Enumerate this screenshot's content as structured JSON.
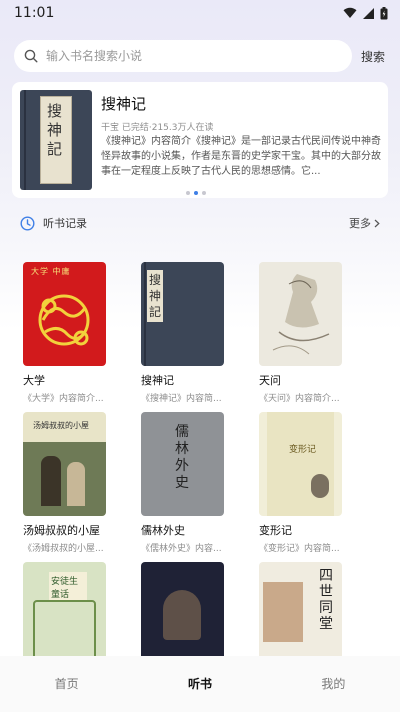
{
  "status_bar": {
    "time": "11:01"
  },
  "search": {
    "placeholder": "输入书名搜索小说",
    "button_label": "搜索"
  },
  "featured": {
    "title": "搜神记",
    "meta": "干宝 已完结·215.3万人在读",
    "description": "《搜神记》内容简介《搜神记》是一部记录古代民间传说中神奇怪异故事的小说集，作者是东晋的史学家干宝。其中的大部分故事在一定程度上反映了古代人民的思想感情。它...",
    "cover_text": "搜神記"
  },
  "carousel": {
    "count": 3,
    "active": 1
  },
  "history": {
    "label": "听书记录",
    "more_label": "更多"
  },
  "books": [
    {
      "title": "大学",
      "desc": "《大学》内容简介...",
      "cover_top": "大学 中庸"
    },
    {
      "title": "搜神记",
      "desc": "《搜神记》内容简...",
      "cover_top": "搜神記"
    },
    {
      "title": "天问",
      "desc": "《天问》内容简介...",
      "cover_top": ""
    },
    {
      "title": "汤姆叔叔的小屋",
      "desc": "《汤姆叔叔的小屋...",
      "cover_top": "汤姆叔叔的小屋"
    },
    {
      "title": "儒林外史",
      "desc": "《儒林外史》内容...",
      "cover_top": "儒林外史"
    },
    {
      "title": "变形记",
      "desc": "《变形记》内容简...",
      "cover_top": "变形记"
    },
    {
      "title": "",
      "desc": "",
      "cover_top": "安徒生童话"
    },
    {
      "title": "",
      "desc": "",
      "cover_top": ""
    },
    {
      "title": "",
      "desc": "",
      "cover_top": "四世同堂"
    }
  ],
  "tabs": [
    {
      "label": "首页",
      "active": false
    },
    {
      "label": "听书",
      "active": true
    },
    {
      "label": "我的",
      "active": false
    }
  ]
}
